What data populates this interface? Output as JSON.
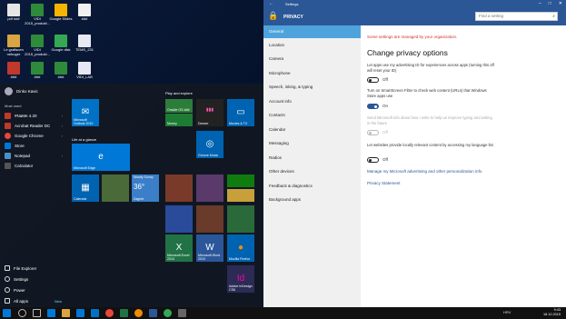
{
  "desktop": {
    "icons": [
      "pdf ###",
      "VIDI 2015_produkt...",
      "Google Slides",
      "###",
      "Le grafiscen nebuger",
      "VIDI 2015_produkt...",
      "Google disk",
      "TEMS_231",
      "###",
      "###",
      "###",
      "VIDI_LAB",
      "Recycle Bin",
      "VIDI",
      "Template...",
      "VIDI_LAB ..."
    ]
  },
  "start_menu": {
    "user": "Dinko Kavic",
    "most_used": "Most used",
    "apps": [
      "#NaMe 4.20",
      "Acrobat Reader DC",
      "Google Chrome",
      "Store",
      "Notepad",
      "Calculator"
    ],
    "bottom": [
      "File Explorer",
      "Settings",
      "Power",
      "All apps"
    ],
    "new_tag": "New",
    "groups": {
      "play": "Play and explore",
      "life": "Life at a glance"
    },
    "tiles": {
      "outlook": "Microsoft Outlook 2010",
      "onenote": "Onside OS ###",
      "money": "Money",
      "deezer": "Deezer",
      "movies": "Movies & TV",
      "edge": "Microsoft Edge",
      "groove": "Groove Music",
      "calendar": "Calendar",
      "weather_title": "Mostly Sunny",
      "weather_temp": "36°",
      "weather_city": "Zagreb",
      "excel": "Microsoft Excel 2010",
      "word": "Microsoft Word 2010",
      "firefox": "Mozilla Firefox",
      "indesign": "Adobe InDesign CS6"
    }
  },
  "settings": {
    "window_title": "Settings",
    "header_title": "PRIVACY",
    "search_placeholder": "Find a setting",
    "nav": [
      "General",
      "Location",
      "Camera",
      "Microphone",
      "Speech, inking, & typing",
      "Account info",
      "Contacts",
      "Calendar",
      "Messaging",
      "Radios",
      "Other devices",
      "Feedback & diagnostics",
      "Background apps"
    ],
    "managed_notice": "Some settings are managed by your organization.",
    "heading": "Change privacy options",
    "options": [
      {
        "text": "Let apps use my advertising ID for experiences across apps (turning this off will reset your ID)",
        "state": "Off"
      },
      {
        "text": "Turn on SmartScreen Filter to check web content (URLs) that Windows Store apps use",
        "state": "On"
      },
      {
        "text": "Send Microsoft info about how I write to help us improve typing and writing in the future",
        "state": "Off"
      },
      {
        "text": "Let websites provide locally relevant content by accessing my language list",
        "state": "Off"
      }
    ],
    "links": [
      "Manage my Microsoft advertising and other personalization info",
      "Privacy Statement"
    ]
  },
  "taskbar": {
    "lang": "HRV",
    "time": "9:43",
    "date": "18.12.2015"
  },
  "colors": {
    "accent": "#2b5797",
    "nav_active": "#4ea3dc",
    "warning": "#d03030"
  }
}
